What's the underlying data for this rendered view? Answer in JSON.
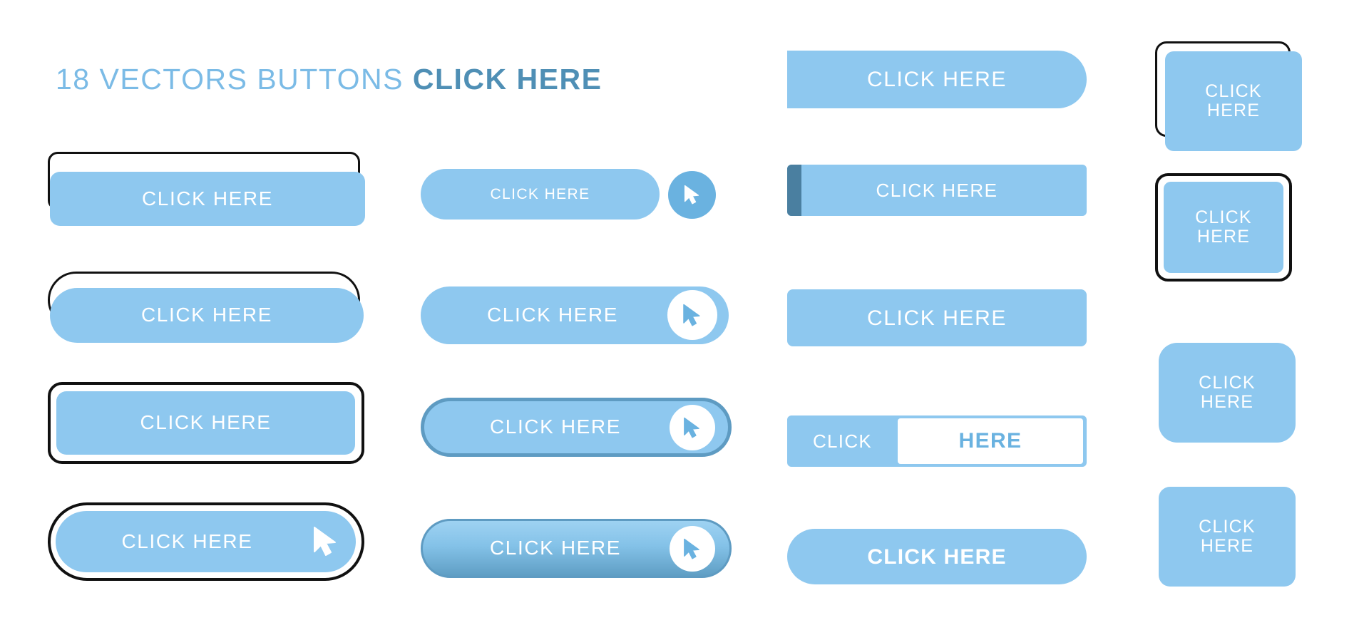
{
  "title": {
    "part1": "18 VECTORS BUTTONS ",
    "part2": "CLICK HERE"
  },
  "colors": {
    "primary_light": "#8ec8ef",
    "primary": "#6ab2e0",
    "dark_accent": "#4a7fa0",
    "outline": "#111111",
    "white": "#ffffff",
    "background": "#ffffff"
  },
  "common_label": "CLICK HERE",
  "buttons": [
    {
      "id": "col1-row1",
      "label": "CLICK HERE",
      "style": "rounded-rect with offset black outline"
    },
    {
      "id": "col1-row2",
      "label": "CLICK HERE",
      "style": "pill with offset black outline"
    },
    {
      "id": "col1-row3",
      "label": "CLICK HERE",
      "style": "rounded-rect inside black rounded frame"
    },
    {
      "id": "col1-row4",
      "label": "CLICK HERE",
      "style": "pill inside black pill frame with cursor"
    },
    {
      "id": "col2-row1",
      "label": "CLICK HERE",
      "style": "pill with separate circular cursor badge"
    },
    {
      "id": "col2-row2",
      "label": "CLICK HERE",
      "style": "pill with inset white circular cursor"
    },
    {
      "id": "col2-row3",
      "label": "CLICK HERE",
      "style": "pill with dark border and white circular cursor"
    },
    {
      "id": "col2-row4",
      "label": "CLICK HERE",
      "style": "gradient pill with white circular cursor"
    },
    {
      "id": "col3-row1",
      "label": "CLICK HERE",
      "style": "half-rounded right pill"
    },
    {
      "id": "col3-row2",
      "label": "CLICK HERE",
      "style": "rect with dark left bar"
    },
    {
      "id": "col3-row3",
      "label": "CLICK HERE",
      "style": "plain rounded rect"
    },
    {
      "id": "col3-row4a",
      "label": "CLICK",
      "style": "split button left segment"
    },
    {
      "id": "col3-row4b",
      "label": "HERE",
      "style": "split button right segment white"
    },
    {
      "id": "col3-row5",
      "label": "CLICK HERE",
      "style": "pill"
    },
    {
      "id": "col4-row1",
      "label": "CLICK HERE",
      "two_line": true,
      "style": "small rounded square with offset black outline"
    },
    {
      "id": "col4-row2",
      "label": "CLICK HERE",
      "two_line": true,
      "style": "small rounded square inside black frame"
    },
    {
      "id": "col4-row3",
      "label": "CLICK HERE",
      "two_line": true,
      "style": "rounded square"
    },
    {
      "id": "col4-row4",
      "label": "CLICK HERE",
      "two_line": true,
      "style": "rounded square"
    }
  ]
}
